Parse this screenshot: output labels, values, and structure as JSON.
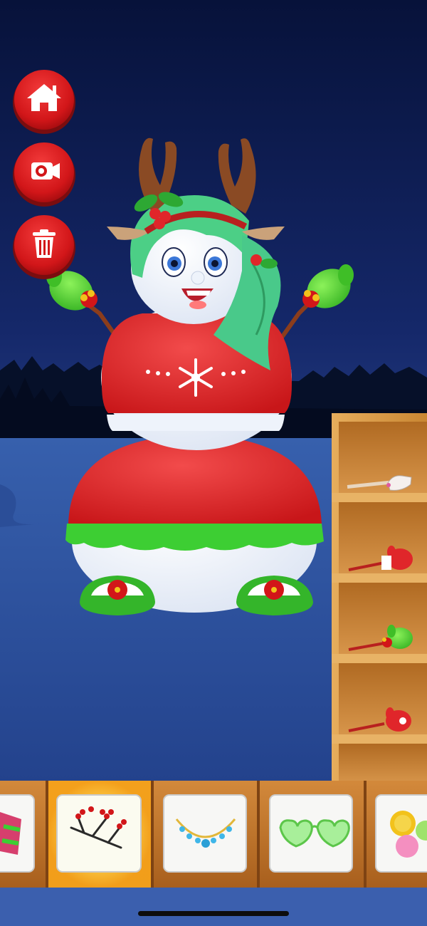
{
  "colors": {
    "sky_top": "#07123a",
    "sky_bottom": "#1d3578",
    "snow": "#2c4f9f",
    "button_red": "#d61a1f",
    "dress_red": "#e0262a",
    "trim_green": "#3dce33",
    "shelf_wood": "#d99a44",
    "card_bg": "#f7f7f5"
  },
  "left_buttons": [
    {
      "name": "home-button",
      "icon": "home-icon"
    },
    {
      "name": "camera-button",
      "icon": "camera-icon"
    },
    {
      "name": "delete-button",
      "icon": "trash-icon"
    }
  ],
  "character": {
    "name": "snowman-character"
  },
  "shelf": {
    "items": [
      {
        "name": "shelf-item-hand-stick",
        "icon": "white-glove-stick-icon"
      },
      {
        "name": "shelf-item-red-mitten",
        "icon": "red-mitten-stick-icon"
      },
      {
        "name": "shelf-item-green-mitten",
        "icon": "green-mitten-stick-icon"
      },
      {
        "name": "shelf-item-patterned-mitten",
        "icon": "patterned-mitten-stick-icon"
      }
    ]
  },
  "category_bar": {
    "selected_index": 1,
    "items": [
      {
        "name": "category-scarf",
        "icon": "scarf-icon"
      },
      {
        "name": "category-berry-branch",
        "icon": "berry-branch-icon"
      },
      {
        "name": "category-necklace",
        "icon": "necklace-icon"
      },
      {
        "name": "category-glasses",
        "icon": "heart-glasses-icon"
      },
      {
        "name": "category-buttons",
        "icon": "buttons-icon"
      }
    ]
  }
}
